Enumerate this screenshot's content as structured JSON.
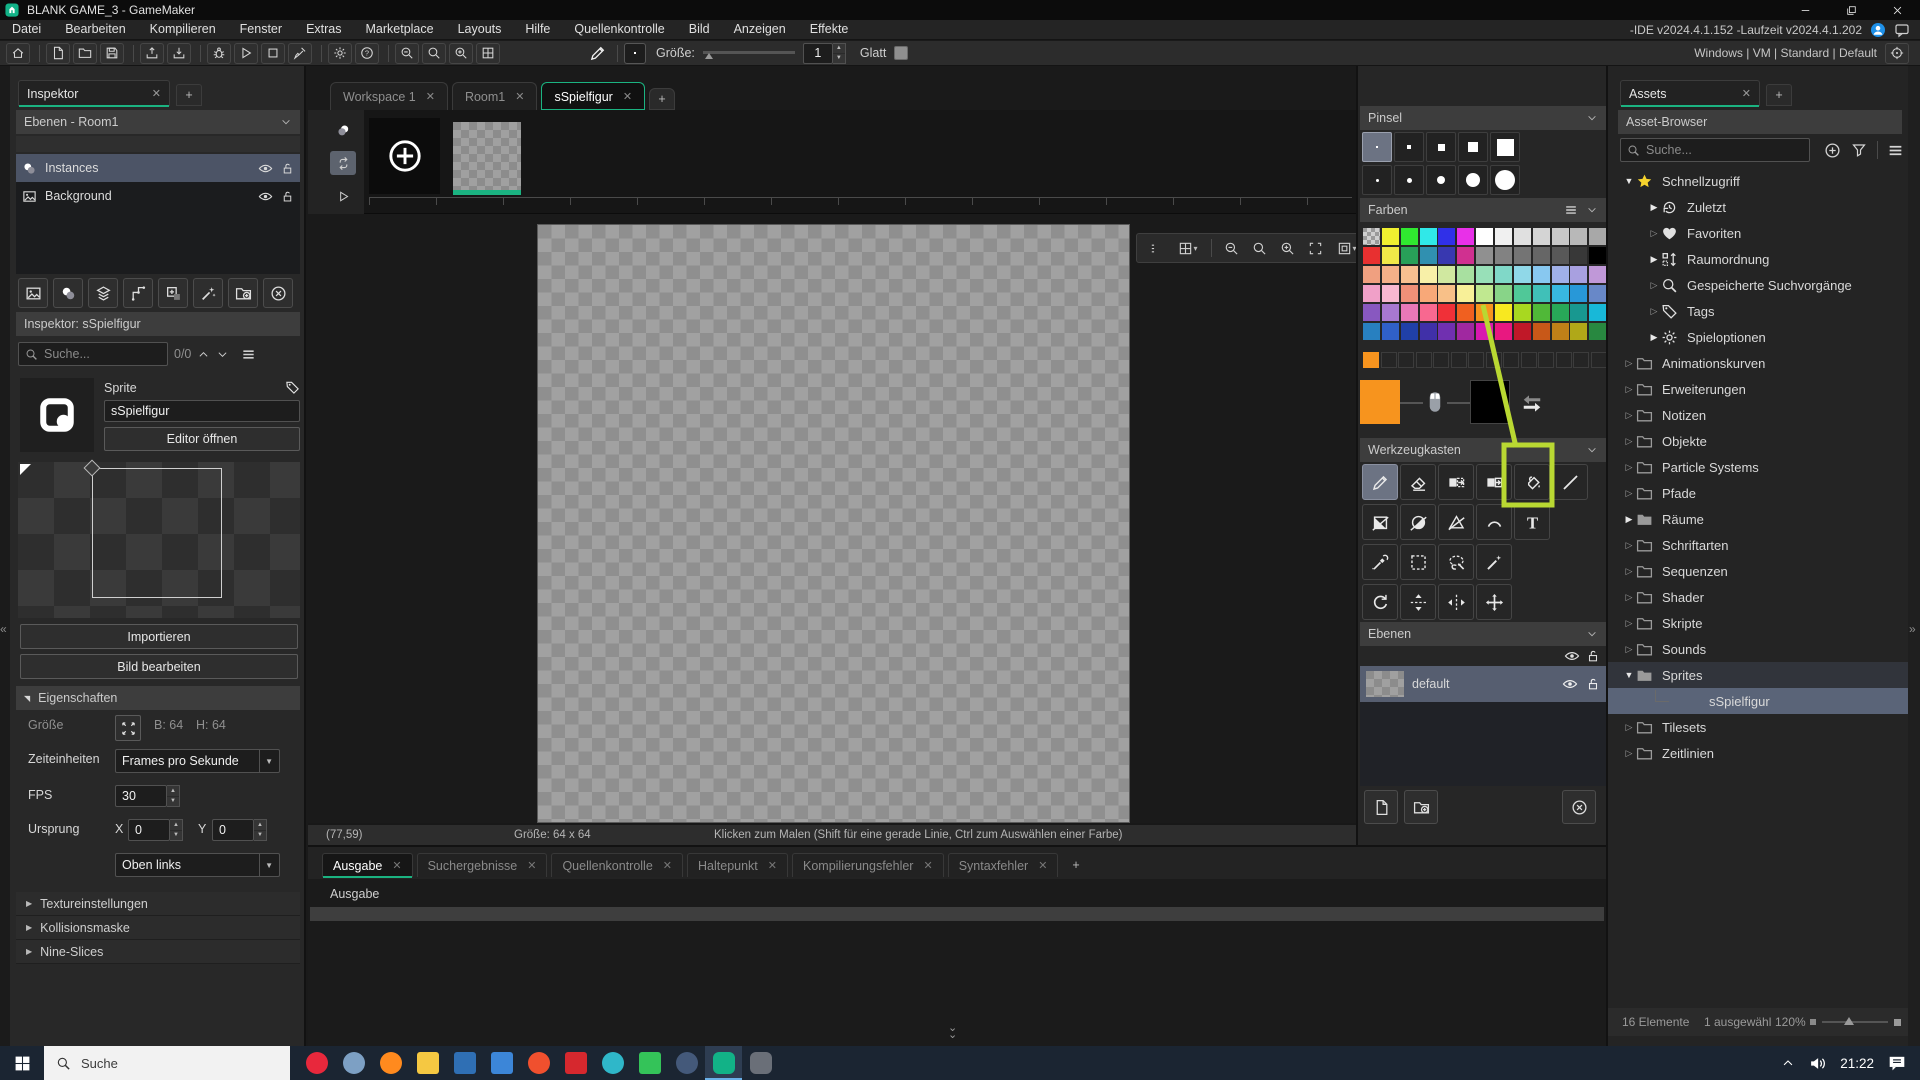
{
  "window": {
    "title": "BLANK GAME_3 - GameMaker"
  },
  "menubar": {
    "items": [
      "Datei",
      "Bearbeiten",
      "Kompilieren",
      "Fenster",
      "Extras",
      "Marketplace",
      "Layouts",
      "Hilfe",
      "Quellenkontrolle",
      "Bild",
      "Anzeigen",
      "Effekte"
    ],
    "version_text": "-IDE v2024.4.1.152 -Laufzeit v2024.4.1.202"
  },
  "toolbar": {
    "left_groups": [
      [
        "home"
      ],
      [
        "doc",
        "folder",
        "save"
      ],
      [
        "tray-up",
        "tray-down"
      ],
      [
        "bug",
        "play",
        "stop",
        "broom"
      ],
      [
        "gear",
        "help"
      ],
      [
        "zoom-out",
        "zoom-reset",
        "zoom-in",
        "room-grid"
      ]
    ],
    "tool_icon": "pencil",
    "size_label": "Größe:",
    "size_value": "1",
    "smooth_label": "Glatt",
    "platform_text": "Windows | VM | Standard | Default"
  },
  "inspector": {
    "tab": "Inspektor",
    "layers_header": "Ebenen - Room1",
    "room_layers": [
      {
        "label": "Instances",
        "icon": "instances",
        "selected": true
      },
      {
        "label": "Background",
        "icon": "image",
        "selected": false
      }
    ],
    "icon_row": [
      "image",
      "instances",
      "layers",
      "path-icon",
      "add-box",
      "wand",
      "folder-plus",
      "x-circle"
    ],
    "header": "Inspektor: sSpielfigur",
    "search_placeholder": "Suche...",
    "search_count": "0/0",
    "sprite_label": "Sprite",
    "sprite_name": "sSpielfigur",
    "open_editor_label": "Editor öffnen",
    "import_label": "Importieren",
    "edit_image_label": "Bild bearbeiten",
    "properties_header": "Eigenschaften",
    "size_label": "Größe",
    "size_b": "B: 64",
    "size_h": "H: 64",
    "time_units_label": "Zeiteinheiten",
    "time_units_value": "Frames pro Sekunde",
    "fps_label": "FPS",
    "fps_value": "30",
    "origin_label": "Ursprung",
    "origin_x_label": "X",
    "origin_x_value": "0",
    "origin_y_label": "Y",
    "origin_y_value": "0",
    "origin_preset_value": "Oben links",
    "collapsed_sections": [
      "Textureinstellungen",
      "Kollisionsmaske",
      "Nine-Slices"
    ]
  },
  "editor": {
    "tabs": [
      {
        "label": "Workspace 1",
        "active": false
      },
      {
        "label": "Room1",
        "active": false
      },
      {
        "label": "sSpielfigur",
        "active": true
      }
    ],
    "canvas_toolbar": [
      "drag-dots",
      "grid-icon",
      "zoom-out",
      "zoom-reset",
      "zoom-in",
      "fit",
      "border-frame"
    ],
    "frame_controls": [
      "onion",
      "loop",
      "play"
    ],
    "statusbar": {
      "coords": "(77,59)",
      "size": "Größe: 64 x 64",
      "hint": "Klicken zum Malen (Shift für eine gerade Linie, Ctrl zum Auswählen einer Farbe)"
    }
  },
  "brushes": {
    "header": "Pinsel",
    "cells": [
      {
        "shape": "square",
        "size": 2,
        "selected": true
      },
      {
        "shape": "square",
        "size": 4,
        "selected": false
      },
      {
        "shape": "square",
        "size": 7,
        "selected": false
      },
      {
        "shape": "square",
        "size": 10,
        "selected": false
      },
      {
        "shape": "square",
        "size": 17,
        "selected": false
      },
      {
        "shape": "circle",
        "size": 3,
        "selected": false
      },
      {
        "shape": "circle",
        "size": 5,
        "selected": false
      },
      {
        "shape": "circle",
        "size": 8,
        "selected": false
      },
      {
        "shape": "circle",
        "size": 14,
        "selected": false
      },
      {
        "shape": "circle",
        "size": 20,
        "selected": false
      }
    ]
  },
  "colors": {
    "header": "Farben",
    "palette": [
      [
        "checker",
        "#f0f030",
        "#30e830",
        "#30e8e8",
        "#3030e8",
        "#e830e8",
        "#ffffff",
        "#f0f0f0",
        "#e0e0e0",
        "#d4d4d4",
        "#c8c8c8",
        "#b8b8b8",
        "#a8a8a8"
      ],
      [
        "#e83030",
        "#f0e848",
        "#28a058",
        "#3090b0",
        "#3838b0",
        "#d03090",
        "#909090",
        "#828282",
        "#747474",
        "#666666",
        "#585858",
        "#383838",
        "#000000"
      ],
      [
        "#f0a080",
        "#f4b088",
        "#f8c090",
        "#f8f0a8",
        "#d0e8a0",
        "#a8e0a0",
        "#98e0b8",
        "#80d8c8",
        "#90d8e8",
        "#88c8f0",
        "#a0b0e8",
        "#a8a0e0",
        "#c098d8"
      ],
      [
        "#f0a0c8",
        "#f8b8d0",
        "#f09078",
        "#f8a878",
        "#f8c088",
        "#f8f098",
        "#c0e890",
        "#88d488",
        "#50c898",
        "#40c0b8",
        "#38b8e0",
        "#2898d8",
        "#6888c8"
      ],
      [
        "#8858c0",
        "#a878d0",
        "#e878b8",
        "#f86890",
        "#f03038",
        "#f06020",
        "#f7941e",
        "#f8e820",
        "#a8d820",
        "#50b838",
        "#28a858",
        "#189890",
        "#18b8d8"
      ],
      [
        "#2880c0",
        "#3060c8",
        "#2040a8",
        "#4030a8",
        "#7030b0",
        "#a028a0",
        "#d818b0",
        "#e81880",
        "#c01828",
        "#c85818",
        "#c08018",
        "#b0a818",
        "#288840"
      ]
    ],
    "recent": [
      "#f7941e"
    ],
    "recent_slots": 14,
    "left_color": "#f7941e",
    "right_color": "#000000"
  },
  "toolbox": {
    "header": "Werkzeugkasten",
    "rows": [
      [
        "pencil",
        "eraser",
        "brush-copy",
        "brush-paste",
        "fill-bucket",
        "line-tool"
      ],
      [
        "rect-tool",
        "ellipse-tool",
        "polygon-tool",
        "arc-tool",
        "text-tool"
      ],
      [
        "eyedropper",
        "select-rect",
        "lasso",
        "magic-wand"
      ],
      [
        "rotate",
        "flip-vertical",
        "flip-horizontal",
        "move"
      ]
    ],
    "selected_tool": "pencil",
    "highlighted_tool": "fill-bucket"
  },
  "sprite_layers": {
    "header": "Ebenen",
    "items": [
      {
        "label": "default",
        "selected": true
      }
    ]
  },
  "assets": {
    "tab": "Assets",
    "browser_header": "Asset-Browser",
    "search_placeholder": "Suche...",
    "tree": [
      {
        "label": "Schnellzugriff",
        "icon": "star",
        "level": 0,
        "arrow": "expanded",
        "icon_color": "#f6d32d"
      },
      {
        "label": "Zuletzt",
        "icon": "history",
        "level": 1,
        "arrow": "filled"
      },
      {
        "label": "Favoriten",
        "icon": "heart",
        "level": 1,
        "arrow": "hollow"
      },
      {
        "label": "Raumordnung",
        "icon": "room-order",
        "level": 1,
        "arrow": "filled"
      },
      {
        "label": "Gespeicherte Suchvorgänge",
        "icon": "search",
        "level": 1,
        "arrow": "hollow"
      },
      {
        "label": "Tags",
        "icon": "tag",
        "level": 1,
        "arrow": "hollow"
      },
      {
        "label": "Spieloptionen",
        "icon": "gear",
        "level": 1,
        "arrow": "filled"
      },
      {
        "label": "Animationskurven",
        "icon": "folder",
        "level": 0,
        "arrow": "hollow"
      },
      {
        "label": "Erweiterungen",
        "icon": "folder",
        "level": 0,
        "arrow": "hollow"
      },
      {
        "label": "Notizen",
        "icon": "folder",
        "level": 0,
        "arrow": "hollow"
      },
      {
        "label": "Objekte",
        "icon": "folder",
        "level": 0,
        "arrow": "hollow"
      },
      {
        "label": "Particle Systems",
        "icon": "folder",
        "level": 0,
        "arrow": "hollow"
      },
      {
        "label": "Pfade",
        "icon": "folder",
        "level": 0,
        "arrow": "hollow"
      },
      {
        "label": "Räume",
        "icon": "folder-filled",
        "level": 0,
        "arrow": "filled"
      },
      {
        "label": "Schriftarten",
        "icon": "folder",
        "level": 0,
        "arrow": "hollow"
      },
      {
        "label": "Sequenzen",
        "icon": "folder",
        "level": 0,
        "arrow": "hollow"
      },
      {
        "label": "Shader",
        "icon": "folder",
        "level": 0,
        "arrow": "hollow"
      },
      {
        "label": "Skripte",
        "icon": "folder",
        "level": 0,
        "arrow": "hollow"
      },
      {
        "label": "Sounds",
        "icon": "folder",
        "level": 0,
        "arrow": "hollow"
      },
      {
        "label": "Sprites",
        "icon": "folder-filled",
        "level": 0,
        "arrow": "expanded",
        "highlight": true
      },
      {
        "label": "sSpielfigur",
        "icon": null,
        "level": 2,
        "arrow": null,
        "selected": true
      },
      {
        "label": "Tilesets",
        "icon": "folder",
        "level": 0,
        "arrow": "hollow"
      },
      {
        "label": "Zeitlinien",
        "icon": "folder",
        "level": 0,
        "arrow": "hollow"
      }
    ],
    "footer": {
      "count": "16 Elemente",
      "selected": "1 ausgewähl",
      "zoom": "120%"
    }
  },
  "output": {
    "tabs": [
      {
        "label": "Ausgabe",
        "active": true
      },
      {
        "label": "Suchergebnisse",
        "active": false
      },
      {
        "label": "Quellenkontrolle",
        "active": false
      },
      {
        "label": "Haltepunkt",
        "active": false
      },
      {
        "label": "Kompilierungsfehler",
        "active": false
      },
      {
        "label": "Syntaxfehler",
        "active": false
      }
    ],
    "content_label": "Ausgabe"
  },
  "taskbar": {
    "search_placeholder": "Suche",
    "time": "21:22",
    "apps": [
      {
        "name": "opera-gx",
        "color": "#e8283c",
        "shape": "circle"
      },
      {
        "name": "steam",
        "color": "#7da0c4",
        "shape": "circle"
      },
      {
        "name": "firefox",
        "color": "#ff8a1e",
        "shape": "circle"
      },
      {
        "name": "file-explorer",
        "color": "#f5c842",
        "shape": "square"
      },
      {
        "name": "terminal",
        "color": "#2f6fb4",
        "shape": "square"
      },
      {
        "name": "mail",
        "color": "#3c86d8",
        "shape": "square"
      },
      {
        "name": "brave",
        "color": "#f0502e",
        "shape": "circle"
      },
      {
        "name": "adobe-reader",
        "color": "#d6282e",
        "shape": "square"
      },
      {
        "name": "browser",
        "color": "#2fb7c9",
        "shape": "circle"
      },
      {
        "name": "spotify",
        "color": "#34c359",
        "shape": "square"
      },
      {
        "name": "steam-alt",
        "color": "#44597a",
        "shape": "circle"
      },
      {
        "name": "gamemaker",
        "color": "#12b287",
        "shape": "rounded",
        "active": true
      },
      {
        "name": "gx-games",
        "color": "#6a6f78",
        "shape": "rounded"
      }
    ]
  },
  "annotation": {
    "color": "#b9d832"
  },
  "accent": {
    "green": "#1bb381"
  }
}
